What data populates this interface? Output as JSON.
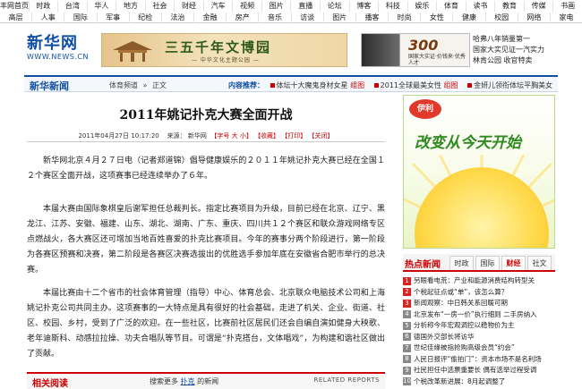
{
  "topnav": {
    "rows": [
      [
        "丰网首页",
        "时政",
        "台湾",
        "华人",
        "地方",
        "社会",
        "财经",
        "汽车",
        "视频",
        "图片",
        "直播",
        "论坛",
        "博客",
        "科技",
        "娱乐",
        "体育",
        "读书",
        "教育",
        "传媒",
        "书画"
      ],
      [
        "高层",
        "人事",
        "国际",
        "军事",
        "纪检",
        "法治",
        "金融",
        "房产",
        "音乐",
        "访谈",
        "图片",
        "播客",
        "时尚",
        "女性",
        "健康",
        "校园",
        "网络",
        "家电"
      ]
    ]
  },
  "header": {
    "logo_text": "新华网",
    "logo_url": "WWW.NEWS.CN",
    "banner1_title": "三五千年文博园",
    "banner1_sub": "— 中华文化主题公园 —",
    "banner2_num": "300",
    "banner2_text": "国家大实证·价钱来·优秀人才",
    "promo_lines": [
      "哈弗八年销量第一",
      "国家大实见证一汽实力",
      "林肯公园  收官特卖"
    ]
  },
  "sectionbar": {
    "title": "新华新闻",
    "crumbs": [
      "体育频道",
      "»",
      "正文"
    ],
    "rec_label": "内容推荐：",
    "rec_items": [
      {
        "text": "体坛十大魔鬼身材女星",
        "hot": "组图"
      },
      {
        "text": "2011全球最美女性",
        "hot": "组图"
      },
      {
        "text": "金妍儿领衔体坛平胸美女",
        "hot": ""
      }
    ]
  },
  "article": {
    "headline": "2011年姚记扑克大赛全面开战",
    "meta": {
      "date": "2011年04月27日 10:17:20",
      "source_label": "来源：",
      "source": "新华网",
      "font_label": "【字号",
      "font_big": "大",
      "font_small": "小】",
      "fav": "【收藏】",
      "print": "【打印】",
      "close": "【关闭】"
    },
    "paragraphs": [
      "新华网北京４月２７日电（记者郑道锦）倡导健康娱乐的２０１１年姚记扑克大赛已经在全国１２个赛区全面开战，这项赛事已经连续举办了６年。",
      "本届大赛由国际象棋皇后谢军担任总裁判长。指定比赛项目为升级，目前已经在北京、辽宁、黑龙江、江苏、安徽、福建、山东、湖北、湖南、广东、重庆、四川共１２个赛区和联众游戏网络专区点燃战火，各大赛区还可增加当地百姓喜爱的扑克比赛项目。今年的赛事分两个阶段进行，第一阶段为各赛区预赛和决赛，第二阶段是各赛区决赛选拔出的优胜选手参加年底在安徽省合肥市举行的总决赛。",
      "本届比赛由十二个省市的社会体育管理（指导）中心、体育总会、北京联众电脑技术公司和上海姚记扑克公司共同主办。这项赛事的一大特点是具有很好的社会基础，走进了机关、企业、街道、社区、校园、乡村，受到了广泛的欢迎。在一些社区，比赛前社区居民们还会自编自演如健身大秧歌、老年迪斯科、动感拉拉操、功夫合唱队等节目。可谓是“扑克搭台，文体唱戏”，为构建和谐社区做出了贡献。"
    ]
  },
  "related": {
    "title": "相关阅读",
    "search_prefix": "搜索更多",
    "keyword": "扑克",
    "search_suffix": "的新闻",
    "en": "RELATED REPORTS"
  },
  "ad": {
    "brand": "伊利",
    "slogan": "改变从今天开始"
  },
  "hot": {
    "title": "热点新闻",
    "tabs": [
      "时政",
      "国际",
      "财经",
      "社文"
    ],
    "active_tab": 2,
    "items": [
      "另眼看电荒：产业和能源消费结构转型关",
      "个税起征点或“单”，该怎么算？",
      "新闻观察：中日韩关系回暖可期",
      "北京发布“一房一价”执行细则  二手房纳入",
      "分析称今年宏观调控以稳物价为主",
      "德国外交部长将访华",
      "世纪佳缘被指抢购高级会员“约会”",
      "人民日报评“偷拍门”：资本市场不是名利场",
      "社民担任中选票重要长  偶有选举过程受调",
      "个税改革新进展：8月起调整了"
    ]
  },
  "colors": {
    "brand_blue": "#0e4ea3",
    "hot_red": "#c00000",
    "ad_green": "#2f8a1f"
  }
}
